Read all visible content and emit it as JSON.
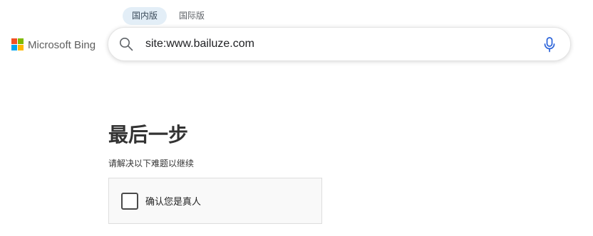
{
  "scope_tabs": [
    {
      "label": "国内版",
      "active": true
    },
    {
      "label": "国际版",
      "active": false
    }
  ],
  "logo": {
    "text": "Microsoft Bing",
    "colors": [
      "#f25022",
      "#7fba00",
      "#00a4ef",
      "#ffb900"
    ]
  },
  "search": {
    "value": "site:www.bailuze.com",
    "search_icon": "search-icon",
    "mic_icon": "microphone-icon",
    "mic_color": "#2b63d9"
  },
  "challenge": {
    "title": "最后一步",
    "subtitle": "请解决以下难题以继续",
    "checkbox_label": "确认您是真人",
    "checked": false
  }
}
